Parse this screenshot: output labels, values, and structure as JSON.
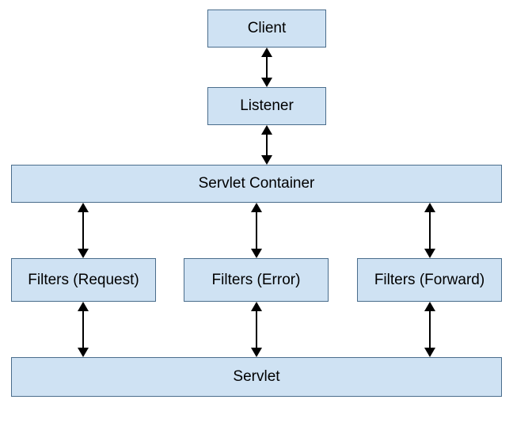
{
  "nodes": {
    "client": "Client",
    "listener": "Listener",
    "container": "Servlet Container",
    "filter_request": "Filters (Request)",
    "filter_error": "Filters (Error)",
    "filter_forward": "Filters (Forward)",
    "servlet": "Servlet"
  },
  "edges": [
    {
      "from": "client",
      "to": "listener",
      "bidirectional": true
    },
    {
      "from": "listener",
      "to": "container",
      "bidirectional": true
    },
    {
      "from": "container",
      "to": "filter_request",
      "bidirectional": true
    },
    {
      "from": "container",
      "to": "filter_error",
      "bidirectional": true
    },
    {
      "from": "container",
      "to": "filter_forward",
      "bidirectional": true
    },
    {
      "from": "filter_request",
      "to": "servlet",
      "bidirectional": true
    },
    {
      "from": "filter_error",
      "to": "servlet",
      "bidirectional": true
    },
    {
      "from": "filter_forward",
      "to": "servlet",
      "bidirectional": true
    }
  ],
  "colors": {
    "box_fill": "#cfe2f3",
    "box_border": "#4a6d8c",
    "arrow": "#000000"
  }
}
